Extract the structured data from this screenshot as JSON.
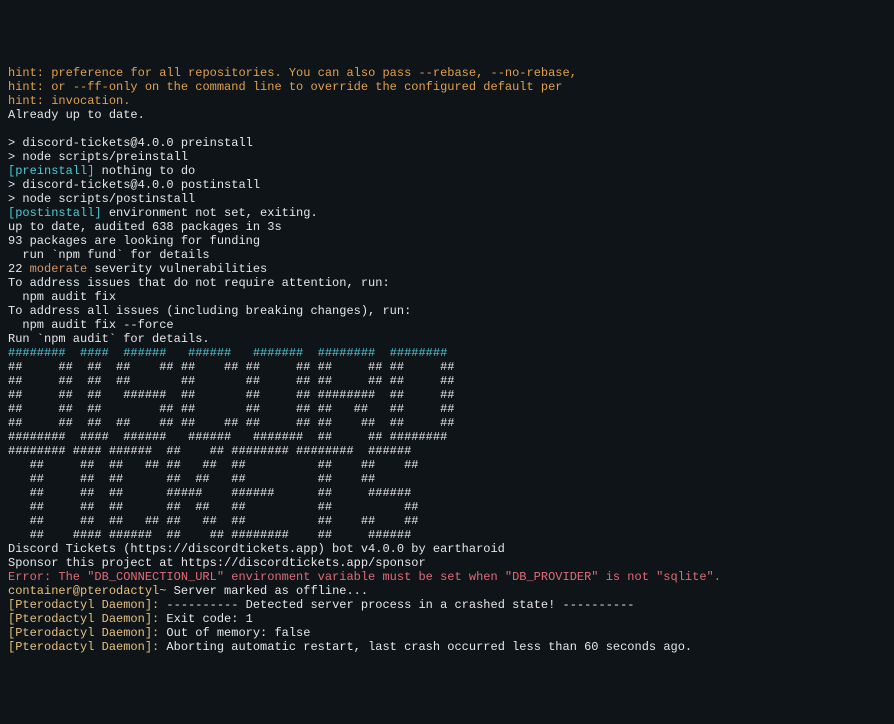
{
  "hints": {
    "l1_prefix": "hint: ",
    "l1": "preference for all repositories. You can also pass --rebase, --no-rebase,",
    "l2_prefix": "hint: ",
    "l2": "or --ff-only on the command line to override the configured default per",
    "l3_prefix": "hint: ",
    "l3": "invocation."
  },
  "uptodate": "Already up to date.",
  "blank": "",
  "preinstall_run1": "> discord-tickets@4.0.0 preinstall",
  "preinstall_run2": "> node scripts/preinstall",
  "preinstall_tag": "[preinstall]",
  "preinstall_msg": " nothing to do",
  "postinstall_run1": "> discord-tickets@4.0.0 postinstall",
  "postinstall_run2": "> node scripts/postinstall",
  "postinstall_tag": "[postinstall]",
  "postinstall_msg": " environment not set, exiting.",
  "audit1": "up to date, audited 638 packages in 3s",
  "audit2": "93 packages are looking for funding",
  "audit3": "  run `npm fund` for details",
  "vuln_count": "22 ",
  "vuln_severity": "moderate",
  "vuln_rest": " severity vulnerabilities",
  "address1": "To address issues that do not require attention, run:",
  "address2": "  npm audit fix",
  "address3": "To address all issues (including breaking changes), run:",
  "address4": "  npm audit fix --force",
  "address5": "Run `npm audit` for details.",
  "ascii1": "########  ####  ######   ######   #######  ########  ######## ",
  "ascii2": "##     ##  ##  ##    ## ##    ## ##     ## ##     ## ##     ##",
  "ascii3": "##     ##  ##  ##       ##       ##     ## ##     ## ##     ##",
  "ascii4": "##     ##  ##   ######  ##       ##     ## ########  ##     ##",
  "ascii5": "##     ##  ##        ## ##       ##     ## ##   ##   ##     ##",
  "ascii6": "##     ##  ##  ##    ## ##    ## ##     ## ##    ##  ##     ##",
  "ascii7": "########  ####  ######   ######   #######  ##     ## ######## ",
  "ascii8": "######## #### ######  ##    ## ######## ########  ######     ",
  "ascii9": "   ##     ##  ##   ## ##   ##  ##          ##    ##    ##    ",
  "ascii10": "   ##     ##  ##      ##  ##   ##          ##    ##          ",
  "ascii11": "   ##     ##  ##      #####    ######      ##     ######     ",
  "ascii12": "   ##     ##  ##      ##  ##   ##          ##          ##    ",
  "ascii13": "   ##     ##  ##   ## ##   ##  ##          ##    ##    ##    ",
  "ascii14": "   ##    #### ######  ##    ## ########    ##     ######     ",
  "credits1": "Discord Tickets (https://discordtickets.app) bot v4.0.0 by eartharoid",
  "credits2": "Sponsor this project at https://discordtickets.app/sponsor",
  "error": "Error: The \"DB_CONNECTION_URL\" environment variable must be set when \"DB_PROVIDER\" is not \"sqlite\".",
  "container_prompt": "container@pterodactyl~",
  "offline_msg": " Server marked as offline...",
  "daemon_tag": "[Pterodactyl Daemon]:",
  "daemon_msg1": " ---------- Detected server process in a crashed state! ----------",
  "daemon_msg2": " Exit code: 1",
  "daemon_msg3": " Out of memory: false",
  "daemon_msg4": " Aborting automatic restart, last crash occurred less than 60 seconds ago."
}
